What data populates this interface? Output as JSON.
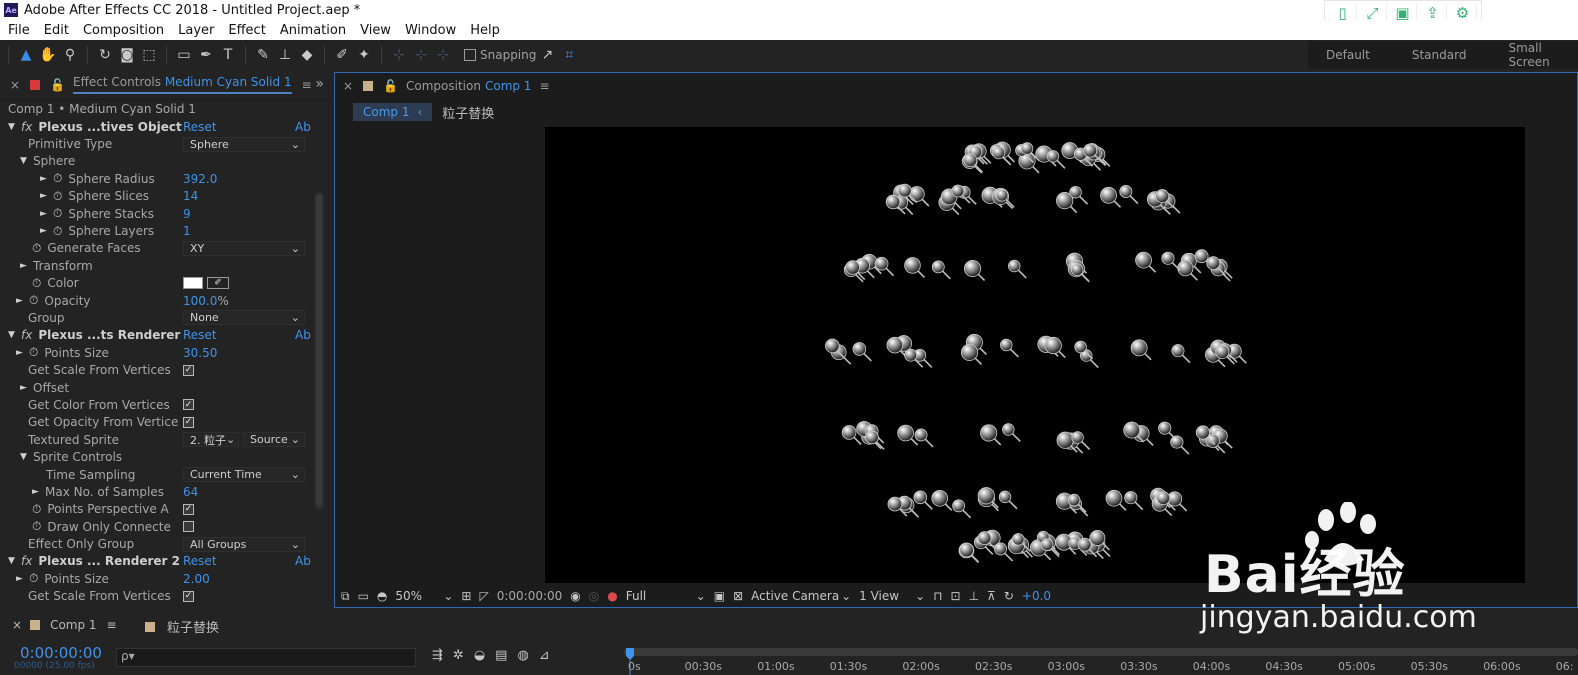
{
  "window": {
    "title": "Adobe After Effects CC 2018 - Untitled Project.aep *",
    "app_badge": "Ae"
  },
  "menu": [
    "File",
    "Edit",
    "Composition",
    "Layer",
    "Effect",
    "Animation",
    "View",
    "Window",
    "Help"
  ],
  "toolbar": {
    "snapping_label": "Snapping"
  },
  "workspaces": [
    "Default",
    "Standard",
    "Small Screen"
  ],
  "effect_controls": {
    "tab_label": "Effect Controls",
    "tab_layer": "Medium Cyan Solid 1",
    "subtitle": "Comp 1 • Medium Cyan Solid 1",
    "fx_label": "fx",
    "reset_label": "Reset",
    "about_label": "Ab",
    "rows": [
      {
        "name": "Plexus ...tives Object",
        "kind": "fx"
      },
      {
        "name": "Primitive Type",
        "dropdown": "Sphere"
      },
      {
        "name": "Sphere",
        "kind": "group-open"
      },
      {
        "name": "Sphere Radius",
        "value": "392.0"
      },
      {
        "name": "Sphere Slices",
        "value": "14"
      },
      {
        "name": "Sphere Stacks",
        "value": "9"
      },
      {
        "name": "Sphere Layers",
        "value": "1"
      },
      {
        "name": "Generate Faces",
        "dropdown": "XY"
      },
      {
        "name": "Transform",
        "kind": "group-closed"
      },
      {
        "name": "Color",
        "kind": "color"
      },
      {
        "name": "Opacity",
        "value": "100.0",
        "unit": "%"
      },
      {
        "name": "Group",
        "dropdown": "None"
      },
      {
        "name": "Plexus ...ts Renderer",
        "kind": "fx"
      },
      {
        "name": "Points Size",
        "value": "30.50"
      },
      {
        "name": "Get Scale From Vertices",
        "checked": true
      },
      {
        "name": "Offset",
        "kind": "group-closed"
      },
      {
        "name": "Get Color From Vertices",
        "checked": true
      },
      {
        "name": "Get Opacity From Vertice",
        "checked": true
      },
      {
        "name": "Textured Sprite",
        "dropdown": "2. 粒子",
        "dropdown2": "Source"
      },
      {
        "name": "Sprite Controls",
        "kind": "group-open"
      },
      {
        "name": "Time Sampling",
        "dropdown": "Current Time"
      },
      {
        "name": "Max No. of Samples",
        "value": "64"
      },
      {
        "name": "Points Perspective A",
        "checked": true
      },
      {
        "name": "Draw Only Connecte",
        "checked": false
      },
      {
        "name": "Effect Only Group",
        "dropdown": "All Groups"
      },
      {
        "name": "Plexus ... Renderer 2",
        "kind": "fx"
      },
      {
        "name": "Points Size",
        "value": "2.00"
      },
      {
        "name": "Get Scale From Vertices",
        "checked": true
      }
    ]
  },
  "composition": {
    "tab_label": "Composition",
    "tab_comp": "Comp 1",
    "crumb_active": "Comp 1",
    "crumb_other": "粒子替换",
    "zoom": "50%",
    "timecode": "0:00:00:00",
    "resolution": "Full",
    "camera": "Active Camera",
    "views": "1 View",
    "exposure": "+0.0"
  },
  "timeline": {
    "tab1": "Comp 1",
    "tab2": "粒子替换",
    "time": "0:00:00:00",
    "fps": "00000 (25.00 fps)",
    "search_placeholder": "ρ▾",
    "ticks": [
      "0s",
      "00:30s",
      "01:00s",
      "01:30s",
      "02:00s",
      "02:30s",
      "03:00s",
      "03:30s",
      "04:00s",
      "04:30s",
      "05:00s",
      "05:30s",
      "06:00s",
      "06:"
    ]
  },
  "watermark": {
    "main": "Bai经验",
    "sub": "jingyan.baidu.com"
  },
  "colors": {
    "accent": "#3f93ea",
    "panel": "#232323",
    "viewer": "#000000",
    "layer_red": "#d63a3a",
    "comp_tan": "#c9b18a"
  }
}
